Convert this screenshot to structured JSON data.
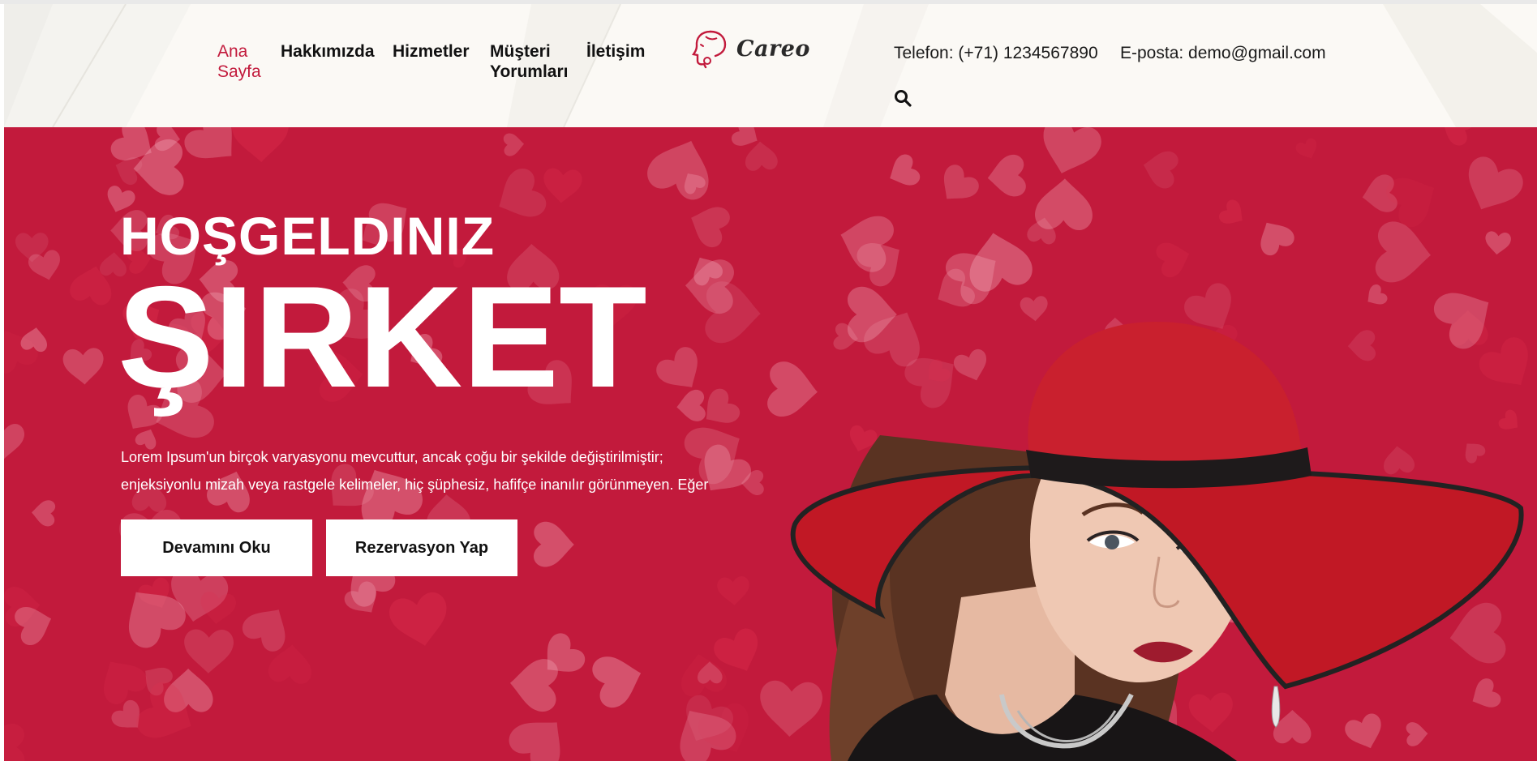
{
  "header": {
    "nav": [
      {
        "label": "Ana\nSayfa",
        "active": true
      },
      {
        "label": "Hakkımızda",
        "active": false
      },
      {
        "label": "Hizmetler",
        "active": false
      },
      {
        "label": "Müşteri\nYorumları",
        "active": false
      },
      {
        "label": "İletişim",
        "active": false
      }
    ],
    "logo_text": "Careo",
    "phone": "Telefon: (+71) 1234567890",
    "email": "E-posta: demo@gmail.com",
    "search_icon": "search-icon"
  },
  "hero": {
    "welcome": "HOŞGELDINIZ",
    "title": "ŞIRKET",
    "text": "Lorem Ipsum'un birçok varyasyonu mevcuttur, ancak çoğu bir şekilde değiştirilmiştir; enjeksiyonlu mizah veya rastgele kelimeler, hiç şüphesiz, hafifçe inanılır görünmeyen. Eğer",
    "read_more": "Devamını Oku",
    "reserve": "Rezervasyon Yap"
  },
  "colors": {
    "accent": "#c21a3c",
    "header_bg": "#fbf9f5",
    "text_dark": "#111111"
  }
}
